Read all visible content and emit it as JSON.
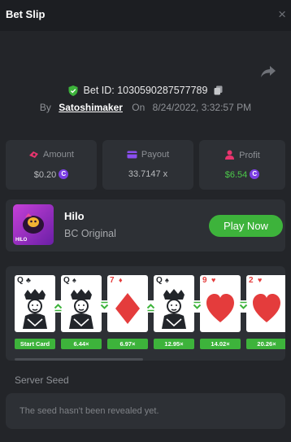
{
  "header": {
    "title": "Bet Slip",
    "close_glyph": "×"
  },
  "bet": {
    "bet_id_label": "Bet ID: 1030590287577789",
    "by_label": "By",
    "username": "Satoshimaker",
    "on_label": "On",
    "datetime": "8/24/2022, 3:32:57 PM"
  },
  "stats": {
    "amount": {
      "label": "Amount",
      "value": "$0.20",
      "icon": "money-icon"
    },
    "payout": {
      "label": "Payout",
      "value": "33.7147 x",
      "icon": "card-icon"
    },
    "profit": {
      "label": "Profit",
      "value": "$6.54",
      "icon": "profit-icon"
    }
  },
  "game": {
    "name": "Hilo",
    "provider": "BC Original",
    "logo_text": "HILO",
    "play_label": "Play Now"
  },
  "cards": [
    {
      "rank": "Q",
      "suit": "♣",
      "color": "black",
      "art": "king-art",
      "multiplier": "Start Card",
      "arrow": ""
    },
    {
      "rank": "Q",
      "suit": "♠",
      "color": "black",
      "art": "king-art",
      "multiplier": "6.44×",
      "arrow": "up"
    },
    {
      "rank": "7",
      "suit": "♦",
      "color": "red",
      "art": "diamond",
      "multiplier": "6.97×",
      "arrow": "down"
    },
    {
      "rank": "Q",
      "suit": "♠",
      "color": "black",
      "art": "king-art",
      "multiplier": "12.95×",
      "arrow": "up"
    },
    {
      "rank": "9",
      "suit": "♥",
      "color": "red",
      "art": "heart",
      "multiplier": "14.02×",
      "arrow": "down"
    },
    {
      "rank": "2",
      "suit": "♥",
      "color": "red",
      "art": "heart",
      "multiplier": "20.26×",
      "arrow": "down"
    }
  ],
  "server_seed": {
    "label": "Server Seed",
    "value": "The seed hasn't been revealed yet."
  },
  "colors": {
    "background": "#232529",
    "panel": "#2d3035",
    "accent_green": "#3db33b",
    "red": "#e43c3c",
    "coin": "#7b3fe4"
  }
}
